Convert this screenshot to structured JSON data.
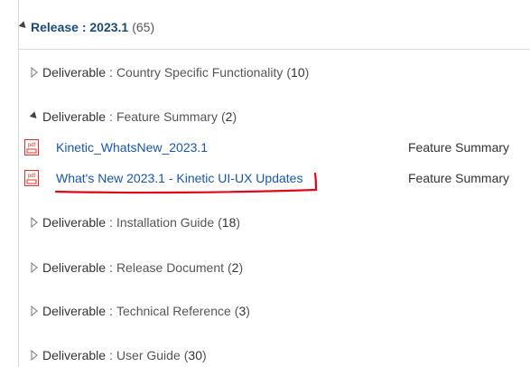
{
  "release": {
    "key": "Release",
    "value": "2023.1",
    "count": "(65)"
  },
  "deliverables": [
    {
      "label": "Deliverable",
      "name": "Country Specific Functionality",
      "count": "10",
      "expanded": false
    },
    {
      "label": "Deliverable",
      "name": "Feature Summary",
      "count": "2",
      "expanded": true
    },
    {
      "label": "Deliverable",
      "name": "Installation Guide",
      "count": "18",
      "expanded": false
    },
    {
      "label": "Deliverable",
      "name": "Release Document",
      "count": "2",
      "expanded": false
    },
    {
      "label": "Deliverable",
      "name": "Technical Reference",
      "count": "3",
      "expanded": false
    },
    {
      "label": "Deliverable",
      "name": "User Guide",
      "count": "30",
      "expanded": false
    }
  ],
  "documents": [
    {
      "title": "Kinetic_WhatsNew_2023.1",
      "type": "Feature Summary",
      "icon": "pdf-icon"
    },
    {
      "title": "What's New 2023.1 - Kinetic UI-UX Updates",
      "type": "Feature Summary",
      "icon": "pdf-icon"
    }
  ],
  "colors": {
    "link": "#1a56a6",
    "release_header": "#1c4a78",
    "annotation": "#e3061b",
    "pdf_icon": "#d9342b"
  }
}
